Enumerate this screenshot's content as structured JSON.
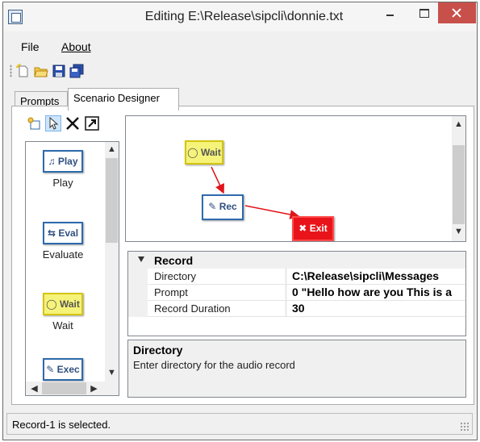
{
  "window": {
    "title": "Editing E:\\Release\\sipcli\\donnie.txt"
  },
  "menu": {
    "file_label": "File",
    "about_label": "About"
  },
  "toolbar": {
    "icons": [
      "new-file-icon",
      "open-folder-icon",
      "save-icon",
      "save-all-icon"
    ]
  },
  "tabs": {
    "prompts": "Prompts",
    "scenario_designer": "Scenario Designer"
  },
  "palette": {
    "items": [
      {
        "icon_text": "Play",
        "label": "Play"
      },
      {
        "icon_text": "Eval",
        "label": "Evaluate"
      },
      {
        "icon_text": "Wait",
        "label": "Wait"
      },
      {
        "icon_text": "Exec",
        "label": ""
      }
    ]
  },
  "diagram": {
    "nodes": {
      "wait": "Wait",
      "rec": "Rec",
      "exit": "Exit"
    }
  },
  "properties": {
    "category": "Record",
    "rows": [
      {
        "name": "Directory",
        "value": "C:\\Release\\sipcli\\Messages"
      },
      {
        "name": "Prompt",
        "value": "0 \"Hello how are you This is a"
      },
      {
        "name": "Record Duration",
        "value": "30"
      }
    ]
  },
  "description": {
    "title": "Directory",
    "text": "Enter directory for the audio record"
  },
  "status": {
    "text": "Record-1 is selected."
  },
  "colors": {
    "close_button": "#c7504b",
    "wait_fill": "#f5f37a",
    "exit_fill": "#e8141a",
    "node_border_blue": "#2e6aad",
    "arrow_red": "#e0141a"
  }
}
